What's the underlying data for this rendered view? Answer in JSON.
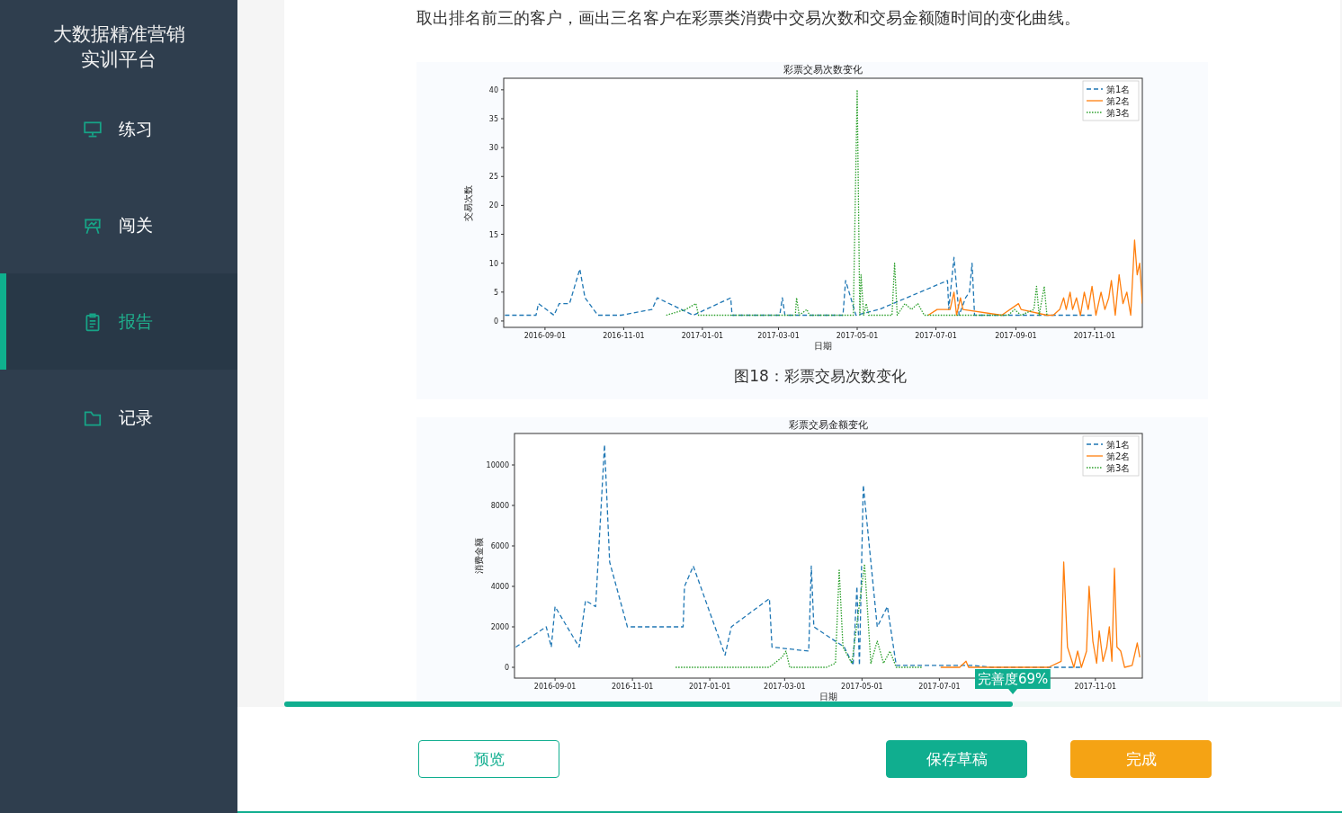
{
  "sidebar": {
    "title": "大数据精准营销实训平台",
    "items": [
      {
        "label": "练习",
        "selected": false
      },
      {
        "label": "闯关",
        "selected": false
      },
      {
        "label": "报告",
        "selected": true
      },
      {
        "label": "记录",
        "selected": false
      }
    ]
  },
  "content": {
    "intro": "取出排名前三的客户，画出三名客户在彩票类消费中交易次数和交易金额随时间的变化曲线。",
    "figures": [
      {
        "caption": "图18：彩票交易次数变化",
        "chart_data": {
          "type": "line",
          "title": "彩票交易次数变化",
          "xlabel": "日期",
          "ylabel": "交易次数",
          "legend": "upper right",
          "xlim": [
            "2016-07-31",
            "2017-12-08"
          ],
          "ylim": [
            -1.1,
            42
          ],
          "xticks": [
            "2016-09-01",
            "2016-11-01",
            "2017-01-01",
            "2017-03-01",
            "2017-05-01",
            "2017-07-01",
            "2017-09-01",
            "2017-11-01"
          ],
          "yticks": [
            0,
            5,
            10,
            15,
            20,
            25,
            30,
            35,
            40
          ],
          "series": [
            {
              "name": "第1名",
              "color": "#1f77b4",
              "line_style": "dashed",
              "x": [
                "2016-08-01",
                "2016-08-25",
                "2016-08-27",
                "2016-09-08",
                "2016-09-12",
                "2016-09-20",
                "2016-09-28",
                "2016-10-02",
                "2016-10-12",
                "2016-10-30",
                "2016-11-23",
                "2016-11-27",
                "2016-12-25",
                "2017-01-23",
                "2017-01-24",
                "2017-03-02",
                "2017-03-04",
                "2017-03-06",
                "2017-04-20",
                "2017-04-22",
                "2017-04-30",
                "2017-05-18",
                "2017-07-10",
                "2017-07-11",
                "2017-07-15",
                "2017-07-19",
                "2017-07-24",
                "2017-07-27",
                "2017-07-29",
                "2017-07-31",
                "2017-10-30"
              ],
              "values": [
                1,
                1,
                3,
                1,
                3,
                3,
                9,
                4,
                1,
                1,
                2,
                4,
                1,
                4,
                1,
                1,
                4,
                1,
                1,
                7,
                1,
                2,
                7,
                2,
                11,
                1,
                4,
                5,
                10,
                1,
                1
              ]
            },
            {
              "name": "第2名",
              "color": "#ff7f0e",
              "line_style": "solid",
              "x": [
                "2017-06-25",
                "2017-07-02",
                "2017-07-12",
                "2017-07-15",
                "2017-07-17",
                "2017-07-20",
                "2017-07-22",
                "2017-08-21",
                "2017-09-03",
                "2017-09-05",
                "2017-09-25",
                "2017-09-30",
                "2017-10-05",
                "2017-10-08",
                "2017-10-10",
                "2017-10-13",
                "2017-10-15",
                "2017-10-18",
                "2017-10-21",
                "2017-10-24",
                "2017-10-27",
                "2017-10-30",
                "2017-11-02",
                "2017-11-06",
                "2017-11-09",
                "2017-11-12",
                "2017-11-14",
                "2017-11-17",
                "2017-11-20",
                "2017-11-23",
                "2017-11-26",
                "2017-11-29",
                "2017-12-02",
                "2017-12-04",
                "2017-12-06",
                "2017-12-08"
              ],
              "values": [
                1,
                2,
                2,
                5,
                1,
                4,
                2,
                1,
                3,
                2,
                1,
                1,
                2,
                4,
                2,
                5,
                2,
                4,
                1,
                5,
                2,
                6,
                1,
                5,
                2,
                4,
                7,
                1,
                8,
                3,
                5,
                1,
                14,
                8,
                10,
                3
              ]
            },
            {
              "name": "第3名",
              "color": "#2ca02c",
              "line_style": "dotted",
              "x": [
                "2016-12-04",
                "2016-12-19",
                "2016-12-27",
                "2016-12-29",
                "2017-03-14",
                "2017-03-15",
                "2017-03-17",
                "2017-03-23",
                "2017-03-25",
                "2017-04-28",
                "2017-05-01",
                "2017-05-03",
                "2017-05-04",
                "2017-05-06",
                "2017-05-08",
                "2017-05-10",
                "2017-05-28",
                "2017-05-30",
                "2017-06-01",
                "2017-06-07",
                "2017-06-12",
                "2017-06-17",
                "2017-06-22",
                "2017-07-07",
                "2017-08-26",
                "2017-08-31",
                "2017-09-05",
                "2017-09-15",
                "2017-09-17",
                "2017-09-19",
                "2017-09-23",
                "2017-09-25"
              ],
              "values": [
                1,
                2,
                3,
                1,
                1,
                4,
                1,
                2,
                1,
                1,
                40,
                1,
                8,
                1,
                3,
                1,
                1,
                10,
                1,
                3,
                2,
                3,
                1,
                1,
                1,
                2,
                1,
                2,
                6,
                1,
                6,
                1
              ]
            }
          ]
        }
      },
      {
        "chart_data": {
          "type": "line",
          "title": "彩票交易金额变化",
          "xlabel": "日期",
          "ylabel": "消费金额",
          "legend": "upper right",
          "xlim": [
            "2016-07-31",
            "2017-12-08"
          ],
          "ylim": [
            -533,
            11556
          ],
          "xticks": [
            "2016-09-01",
            "2016-11-01",
            "2017-01-01",
            "2017-03-01",
            "2017-05-01",
            "2017-07-01",
            "2017-11-01"
          ],
          "yticks": [
            0,
            2000,
            4000,
            6000,
            8000,
            10000
          ],
          "series": [
            {
              "name": "第1名",
              "color": "#1f77b4",
              "line_style": "dashed",
              "x": [
                "2016-08-01",
                "2016-08-25",
                "2016-08-29",
                "2016-09-01",
                "2016-09-20",
                "2016-09-25",
                "2016-10-03",
                "2016-10-10",
                "2016-10-14",
                "2016-10-28",
                "2016-12-11",
                "2016-12-12",
                "2016-12-19",
                "2017-01-13",
                "2017-01-18",
                "2017-02-17",
                "2017-02-19",
                "2017-03-20",
                "2017-03-22",
                "2017-03-24",
                "2017-04-17",
                "2017-04-24",
                "2017-04-27",
                "2017-04-29",
                "2017-05-02",
                "2017-05-13",
                "2017-05-21",
                "2017-05-28",
                "2017-07-27",
                "2017-08-11",
                "2017-10-20"
              ],
              "values": [
                1000,
                2000,
                1000,
                3000,
                1000,
                3300,
                3000,
                11000,
                5200,
                2000,
                2000,
                4000,
                5000,
                600,
                2000,
                3400,
                1000,
                800,
                5000,
                2000,
                1000,
                100,
                4000,
                100,
                9000,
                2000,
                3000,
                100,
                100,
                0,
                0
              ]
            },
            {
              "name": "第2名",
              "color": "#ff7f0e",
              "line_style": "solid",
              "x": [
                "2017-07-02",
                "2017-07-17",
                "2017-07-22",
                "2017-07-24",
                "2017-09-25",
                "2017-10-05",
                "2017-10-07",
                "2017-10-10",
                "2017-10-15",
                "2017-10-18",
                "2017-10-21",
                "2017-10-25",
                "2017-10-27",
                "2017-10-30",
                "2017-11-02",
                "2017-11-04",
                "2017-11-07",
                "2017-11-10",
                "2017-11-12",
                "2017-11-14",
                "2017-11-16",
                "2017-11-18",
                "2017-11-21",
                "2017-11-24",
                "2017-11-30",
                "2017-12-04",
                "2017-12-06"
              ],
              "values": [
                0,
                0,
                300,
                0,
                0,
                300,
                5200,
                1000,
                0,
                800,
                0,
                800,
                4000,
                1300,
                200,
                1800,
                300,
                1000,
                2000,
                300,
                4900,
                1000,
                800,
                0,
                100,
                1200,
                500
              ]
            },
            {
              "name": "第3名",
              "color": "#2ca02c",
              "line_style": "dotted",
              "x": [
                "2016-12-05",
                "2017-02-17",
                "2017-02-27",
                "2017-03-02",
                "2017-03-05",
                "2017-04-03",
                "2017-04-10",
                "2017-04-13",
                "2017-04-16",
                "2017-04-23",
                "2017-05-03",
                "2017-05-08",
                "2017-05-13",
                "2017-05-18",
                "2017-05-23",
                "2017-05-28",
                "2017-06-17"
              ],
              "values": [
                0,
                0,
                500,
                800,
                0,
                0,
                200,
                4800,
                1000,
                200,
                5100,
                200,
                1300,
                200,
                800,
                0,
                0
              ]
            }
          ]
        }
      }
    ]
  },
  "progress": {
    "level": 0.69,
    "badge": "完善度69%"
  },
  "buttons": [
    {
      "label": "预览",
      "kind": "outline"
    },
    {
      "label": "保存草稿",
      "kind": "primary"
    },
    {
      "label": "完成",
      "kind": "warning"
    }
  ]
}
